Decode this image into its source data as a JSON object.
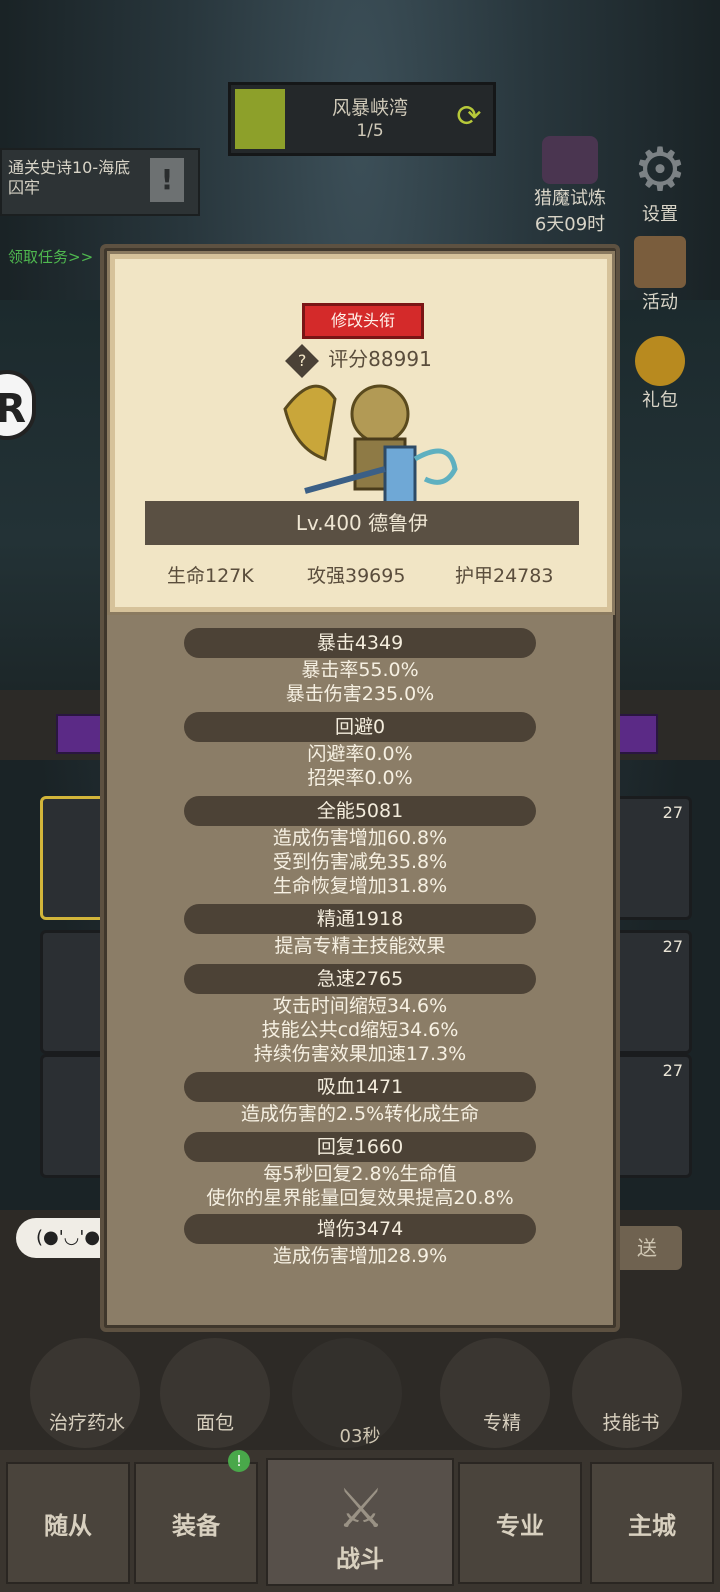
{
  "top": {
    "mode_title": "风暴峡湾",
    "mode_progress": "1/5",
    "quest_text": "通关史诗10-海底囚牢",
    "quest_link": "领取任务>>",
    "trial_label": "猎魔试炼",
    "trial_time": "6天09时",
    "settings_label": "设置",
    "activity_label": "活动",
    "gift_label": "礼包"
  },
  "panel": {
    "edit_title_button": "修改头衔",
    "score": "评分88991",
    "hero_name": "Lv.400 德鲁伊",
    "hp": "生命127K",
    "attack": "攻强39695",
    "armor": "护甲24783",
    "stats": [
      {
        "head": "暴击4349",
        "lines": [
          "暴击率55.0%",
          "暴击伤害235.0%"
        ]
      },
      {
        "head": "回避0",
        "lines": [
          "闪避率0.0%",
          "招架率0.0%"
        ]
      },
      {
        "head": "全能5081",
        "lines": [
          "造成伤害增加60.8%",
          "受到伤害减免35.8%",
          "生命恢复增加31.8%"
        ]
      },
      {
        "head": "精通1918",
        "lines": [
          "提高专精主技能效果"
        ]
      },
      {
        "head": "急速2765",
        "lines": [
          "攻击时间缩短34.6%",
          "技能公共cd缩短34.6%",
          "持续伤害效果加速17.3%"
        ]
      },
      {
        "head": "吸血1471",
        "lines": [
          "造成伤害的2.5%转化成生命"
        ]
      },
      {
        "head": "回复1660",
        "lines": [
          "每5秒回复2.8%生命值",
          "使你的星界能量回复效果提高20.8%"
        ]
      },
      {
        "head": "增伤3474",
        "lines": [
          "造成伤害增加28.9%"
        ]
      }
    ]
  },
  "background": {
    "slot_levels": [
      "27",
      "27",
      "27"
    ],
    "chat_prefix": "(●'◡'●",
    "send_label": "送",
    "quick_items": [
      "治疗药水",
      "面包",
      "专精",
      "技能书"
    ],
    "timer": "03秒",
    "tabs": [
      "随从",
      "装备",
      "战斗",
      "专业",
      "主城"
    ],
    "badge": "!"
  }
}
